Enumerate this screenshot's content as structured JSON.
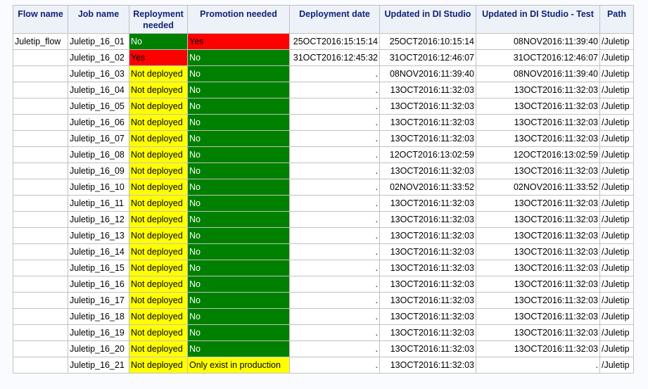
{
  "headers": [
    "Flow name",
    "Job name",
    "Reployment needed",
    "Promotion needed",
    "Deployment date",
    "Updated in DI Studio",
    "Updated in DI Studio - Test",
    "Path"
  ],
  "colors": {
    "green": "#008000",
    "red": "#ff0000",
    "yellow": "#ffff00"
  },
  "rows": [
    {
      "flow": "Juletip_flow",
      "job": "Juletip_16_01",
      "reploy": "No",
      "reploy_color": "green",
      "promo": "Yes",
      "promo_color": "red",
      "deploy": "25OCT2016:15:15:14",
      "di": "25OCT2016:10:15:14",
      "test": "08NOV2016:11:39:40",
      "path": "/Juletip"
    },
    {
      "flow": "",
      "job": "Juletip_16_02",
      "reploy": "Yes",
      "reploy_color": "red",
      "promo": "No",
      "promo_color": "green",
      "deploy": "31OCT2016:12:45:32",
      "di": "31OCT2016:12:46:07",
      "test": "31OCT2016:12:46:07",
      "path": "/Juletip"
    },
    {
      "flow": "",
      "job": "Juletip_16_03",
      "reploy": "Not deployed",
      "reploy_color": "yellow",
      "promo": "No",
      "promo_color": "green",
      "deploy": ".",
      "di": "08NOV2016:11:39:40",
      "test": "08NOV2016:11:39:40",
      "path": "/Juletip"
    },
    {
      "flow": "",
      "job": "Juletip_16_04",
      "reploy": "Not deployed",
      "reploy_color": "yellow",
      "promo": "No",
      "promo_color": "green",
      "deploy": ".",
      "di": "13OCT2016:11:32:03",
      "test": "13OCT2016:11:32:03",
      "path": "/Juletip"
    },
    {
      "flow": "",
      "job": "Juletip_16_05",
      "reploy": "Not deployed",
      "reploy_color": "yellow",
      "promo": "No",
      "promo_color": "green",
      "deploy": ".",
      "di": "13OCT2016:11:32:03",
      "test": "13OCT2016:11:32:03",
      "path": "/Juletip"
    },
    {
      "flow": "",
      "job": "Juletip_16_06",
      "reploy": "Not deployed",
      "reploy_color": "yellow",
      "promo": "No",
      "promo_color": "green",
      "deploy": ".",
      "di": "13OCT2016:11:32:03",
      "test": "13OCT2016:11:32:03",
      "path": "/Juletip"
    },
    {
      "flow": "",
      "job": "Juletip_16_07",
      "reploy": "Not deployed",
      "reploy_color": "yellow",
      "promo": "No",
      "promo_color": "green",
      "deploy": ".",
      "di": "13OCT2016:11:32:03",
      "test": "13OCT2016:11:32:03",
      "path": "/Juletip"
    },
    {
      "flow": "",
      "job": "Juletip_16_08",
      "reploy": "Not deployed",
      "reploy_color": "yellow",
      "promo": "No",
      "promo_color": "green",
      "deploy": ".",
      "di": "12OCT2016:13:02:59",
      "test": "12OCT2016:13:02:59",
      "path": "/Juletip"
    },
    {
      "flow": "",
      "job": "Juletip_16_09",
      "reploy": "Not deployed",
      "reploy_color": "yellow",
      "promo": "No",
      "promo_color": "green",
      "deploy": ".",
      "di": "13OCT2016:11:32:03",
      "test": "13OCT2016:11:32:03",
      "path": "/Juletip"
    },
    {
      "flow": "",
      "job": "Juletip_16_10",
      "reploy": "Not deployed",
      "reploy_color": "yellow",
      "promo": "No",
      "promo_color": "green",
      "deploy": ".",
      "di": "02NOV2016:11:33:52",
      "test": "02NOV2016:11:33:52",
      "path": "/Juletip"
    },
    {
      "flow": "",
      "job": "Juletip_16_11",
      "reploy": "Not deployed",
      "reploy_color": "yellow",
      "promo": "No",
      "promo_color": "green",
      "deploy": ".",
      "di": "13OCT2016:11:32:03",
      "test": "13OCT2016:11:32:03",
      "path": "/Juletip"
    },
    {
      "flow": "",
      "job": "Juletip_16_12",
      "reploy": "Not deployed",
      "reploy_color": "yellow",
      "promo": "No",
      "promo_color": "green",
      "deploy": ".",
      "di": "13OCT2016:11:32:03",
      "test": "13OCT2016:11:32:03",
      "path": "/Juletip"
    },
    {
      "flow": "",
      "job": "Juletip_16_13",
      "reploy": "Not deployed",
      "reploy_color": "yellow",
      "promo": "No",
      "promo_color": "green",
      "deploy": ".",
      "di": "13OCT2016:11:32:03",
      "test": "13OCT2016:11:32:03",
      "path": "/Juletip"
    },
    {
      "flow": "",
      "job": "Juletip_16_14",
      "reploy": "Not deployed",
      "reploy_color": "yellow",
      "promo": "No",
      "promo_color": "green",
      "deploy": ".",
      "di": "13OCT2016:11:32:03",
      "test": "13OCT2016:11:32:03",
      "path": "/Juletip"
    },
    {
      "flow": "",
      "job": "Juletip_16_15",
      "reploy": "Not deployed",
      "reploy_color": "yellow",
      "promo": "No",
      "promo_color": "green",
      "deploy": ".",
      "di": "13OCT2016:11:32:03",
      "test": "13OCT2016:11:32:03",
      "path": "/Juletip"
    },
    {
      "flow": "",
      "job": "Juletip_16_16",
      "reploy": "Not deployed",
      "reploy_color": "yellow",
      "promo": "No",
      "promo_color": "green",
      "deploy": ".",
      "di": "13OCT2016:11:32:03",
      "test": "13OCT2016:11:32:03",
      "path": "/Juletip"
    },
    {
      "flow": "",
      "job": "Juletip_16_17",
      "reploy": "Not deployed",
      "reploy_color": "yellow",
      "promo": "No",
      "promo_color": "green",
      "deploy": ".",
      "di": "13OCT2016:11:32:03",
      "test": "13OCT2016:11:32:03",
      "path": "/Juletip"
    },
    {
      "flow": "",
      "job": "Juletip_16_18",
      "reploy": "Not deployed",
      "reploy_color": "yellow",
      "promo": "No",
      "promo_color": "green",
      "deploy": ".",
      "di": "13OCT2016:11:32:03",
      "test": "13OCT2016:11:32:03",
      "path": "/Juletip"
    },
    {
      "flow": "",
      "job": "Juletip_16_19",
      "reploy": "Not deployed",
      "reploy_color": "yellow",
      "promo": "No",
      "promo_color": "green",
      "deploy": ".",
      "di": "13OCT2016:11:32:03",
      "test": "13OCT2016:11:32:03",
      "path": "/Juletip"
    },
    {
      "flow": "",
      "job": "Juletip_16_20",
      "reploy": "Not deployed",
      "reploy_color": "yellow",
      "promo": "No",
      "promo_color": "green",
      "deploy": ".",
      "di": "13OCT2016:11:32:03",
      "test": "13OCT2016:11:32:03",
      "path": "/Juletip"
    },
    {
      "flow": "",
      "job": "Juletip_16_21",
      "reploy": "Not deployed",
      "reploy_color": "yellow",
      "promo": "Only exist in production",
      "promo_color": "yellow",
      "deploy": ".",
      "di": "13OCT2016:11:32:03",
      "test": ".",
      "path": "/Juletip"
    }
  ]
}
